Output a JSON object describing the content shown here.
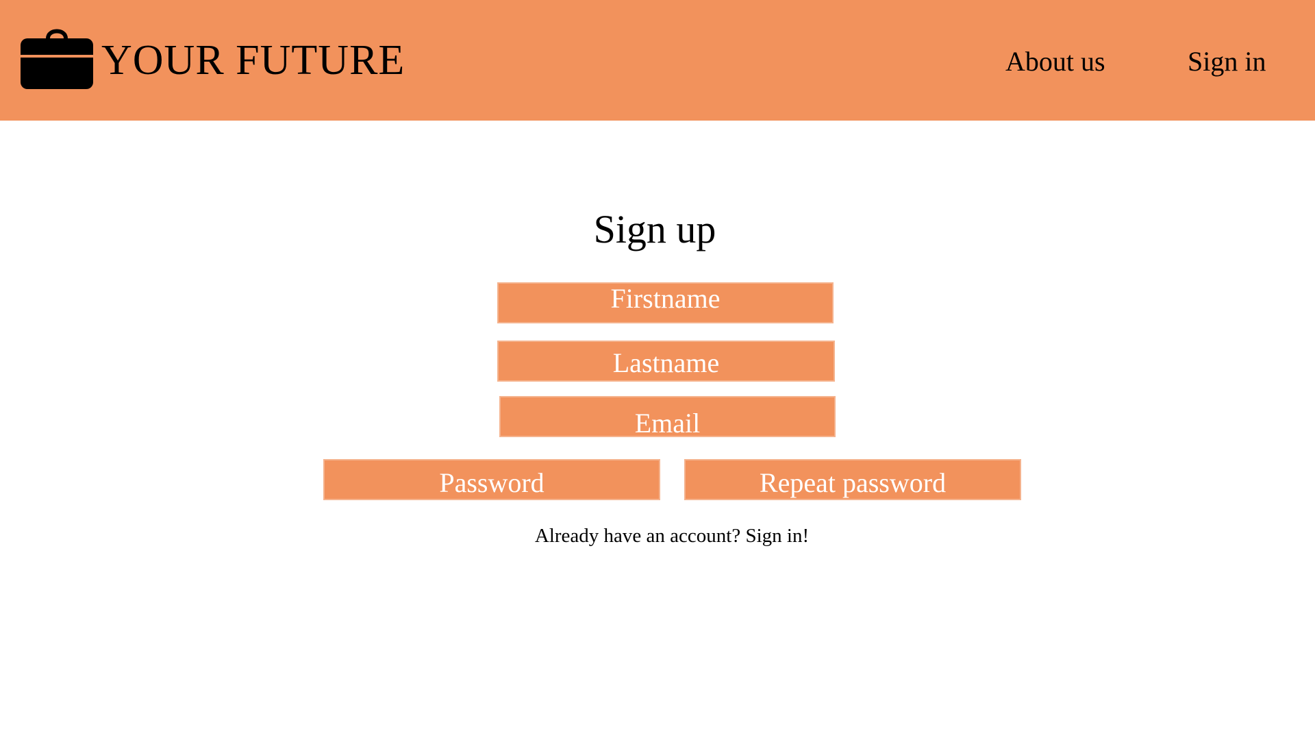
{
  "header": {
    "logo_icon": "briefcase-icon",
    "brand_name": "YOUR FUTURE",
    "nav": {
      "about_label": "About us",
      "signin_label": "Sign in"
    }
  },
  "form": {
    "title": "Sign up",
    "fields": {
      "firstname_placeholder": "Firstname",
      "lastname_placeholder": "Lastname",
      "email_placeholder": "Email",
      "password_placeholder": "Password",
      "repeat_password_placeholder": "Repeat password"
    },
    "signin_prompt": {
      "text": "Already have an account? ",
      "link": "Sign in!"
    }
  },
  "colors": {
    "accent": "#F2925C",
    "field_border": "#F5B38E",
    "text": "#000000",
    "field_text": "#ffffff",
    "background": "#ffffff"
  }
}
